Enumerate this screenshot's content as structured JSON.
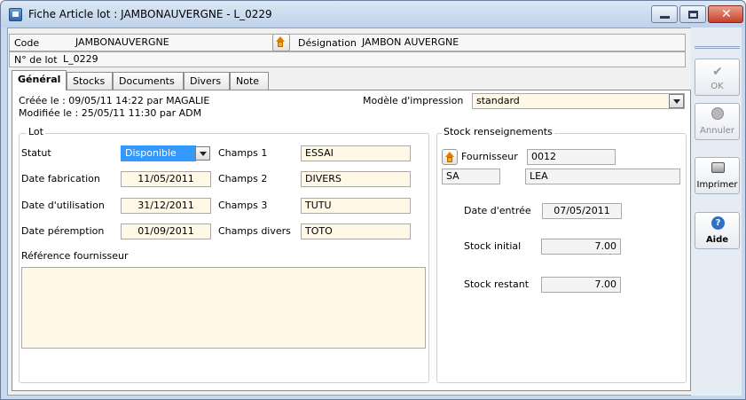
{
  "window": {
    "title": "Fiche Article lot : JAMBONAUVERGNE - L_0229"
  },
  "header": {
    "code_label": "Code",
    "code_value": "JAMBONAUVERGNE",
    "designation_label": "Désignation",
    "designation_value": "JAMBON AUVERGNE",
    "lot_label": "N° de lot",
    "lot_value": "L_0229"
  },
  "tabs": [
    {
      "label": "Général"
    },
    {
      "label": "Stocks"
    },
    {
      "label": "Documents"
    },
    {
      "label": "Divers"
    },
    {
      "label": "Note"
    }
  ],
  "general": {
    "created": "Créée le    : 09/05/11 14:22 par MAGALIE",
    "modified": "Modifiée le : 25/05/11 11:30 par ADM",
    "print_model_label": "Modèle d'impression",
    "print_model_value": "standard",
    "lot_group": {
      "title": "Lot",
      "statut_label": "Statut",
      "statut_value": "Disponible",
      "date_fab_label": "Date fabrication",
      "date_fab_value": "11/05/2011",
      "date_util_label": "Date d'utilisation",
      "date_util_value": "31/12/2011",
      "date_perem_label": "Date péremption",
      "date_perem_value": "01/09/2011",
      "ref_fourn_label": "Référence fournisseur",
      "champs1_label": "Champs 1",
      "champs1_value": "ESSAI",
      "champs2_label": "Champs 2",
      "champs2_value": "DIVERS",
      "champs3_label": "Champs 3",
      "champs3_value": "TUTU",
      "champs_divers_label": "Champs divers",
      "champs_divers_value": "TOTO"
    },
    "stock_group": {
      "title": "Stock renseignements",
      "fournisseur_label": "Fournisseur",
      "fournisseur_code": "0012",
      "fournisseur_sa": "SA",
      "fournisseur_name": "LEA",
      "date_entree_label": "Date d'entrée",
      "date_entree_value": "07/05/2011",
      "stock_initial_label": "Stock initial",
      "stock_initial_value": "7.00",
      "stock_restant_label": "Stock restant",
      "stock_restant_value": "7.00"
    }
  },
  "toolbar": {
    "ok": "OK",
    "annuler": "Annuler",
    "imprimer": "Imprimer",
    "aide": "Aide"
  },
  "colors": {
    "field_bg": "#fff8e7",
    "selection": "#3399ff",
    "title_bg": "#c9d9ec"
  }
}
